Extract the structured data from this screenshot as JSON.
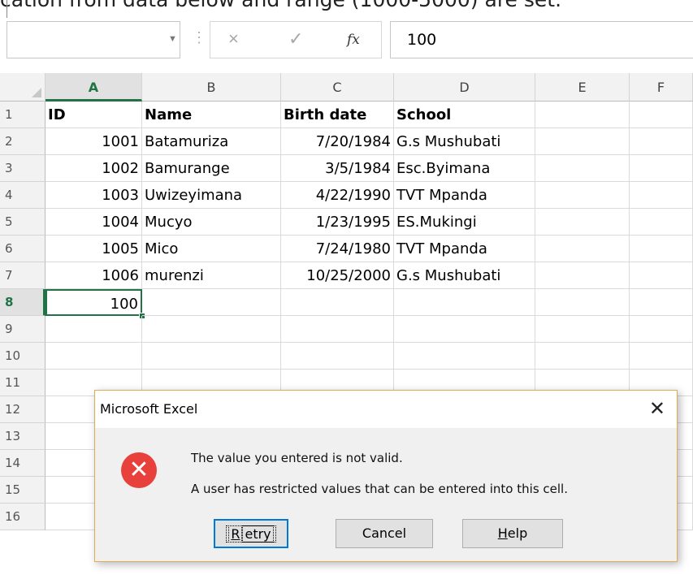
{
  "window": {
    "cut_text": "cation from data below and range (1000-5000) are set."
  },
  "formula_bar": {
    "name_box_value": "",
    "cancel_icon": "×",
    "enter_icon": "✓",
    "fx_icon": "fx",
    "content": "100"
  },
  "grid": {
    "columns": [
      "A",
      "B",
      "C",
      "D",
      "E",
      "F"
    ],
    "rows": [
      "1",
      "2",
      "3",
      "4",
      "5",
      "6",
      "7",
      "8",
      "9",
      "10",
      "11",
      "12",
      "13",
      "14",
      "15",
      "16"
    ],
    "active_column": "A",
    "active_row": "8",
    "data": [
      [
        "ID",
        "Name",
        "Birth date",
        "School"
      ],
      [
        "1001",
        "Batamuriza",
        "7/20/1984",
        "G.s Mushubati"
      ],
      [
        "1002",
        "Bamurange",
        "3/5/1984",
        "Esc.Byimana"
      ],
      [
        "1003",
        "Uwizeyimana",
        "4/22/1990",
        "TVT Mpanda"
      ],
      [
        "1004",
        "Mucyo",
        "1/23/1995",
        "ES.Mukingi"
      ],
      [
        "1005",
        "Mico",
        "7/24/1980",
        "TVT Mpanda"
      ],
      [
        "1006",
        "murenzi",
        "10/25/2000",
        "G.s Mushubati"
      ],
      [
        "100",
        "",
        "",
        ""
      ]
    ]
  },
  "dialog": {
    "title": "Microsoft Excel",
    "close_glyph": "✕",
    "icon_glyph": "✕",
    "message_line1": "The value you entered is not valid.",
    "message_line2": "A user has restricted values that can be entered into this cell.",
    "retry_label": {
      "ul": "R",
      "rest": "etry"
    },
    "cancel_label": "Cancel",
    "help_label": {
      "ul": "H",
      "rest": "elp"
    }
  },
  "colors": {
    "excel_green": "#217346",
    "error_red": "#e8403a",
    "dialog_border": "#e2a957",
    "focus_blue": "#0078d7"
  }
}
